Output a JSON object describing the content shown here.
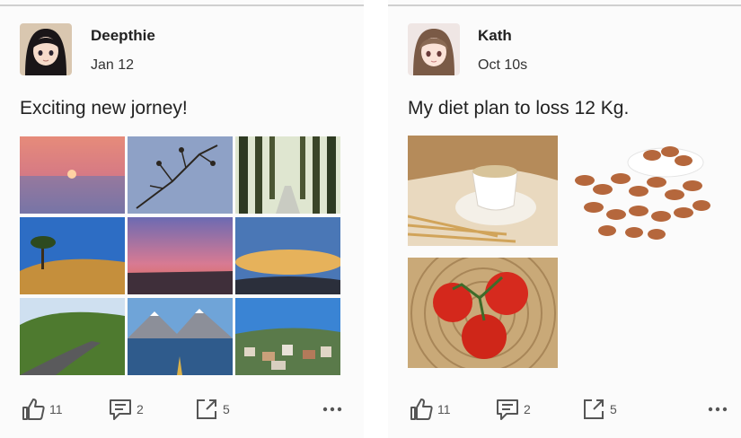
{
  "posts": [
    {
      "author": "Deepthie",
      "date": "Jan 12",
      "text": "Exciting new jorney!",
      "likes": "11",
      "comments": "2",
      "shares": "5"
    },
    {
      "author": "Kath",
      "date": "Oct 10s",
      "text": "My diet plan to loss 12 Kg.",
      "likes": "11",
      "comments": "2",
      "shares": "5"
    }
  ],
  "colors": {
    "icon": "#555555",
    "text": "#222222"
  },
  "icons": [
    "thumbs-up-icon",
    "comment-icon",
    "share-icon",
    "more-icon"
  ]
}
